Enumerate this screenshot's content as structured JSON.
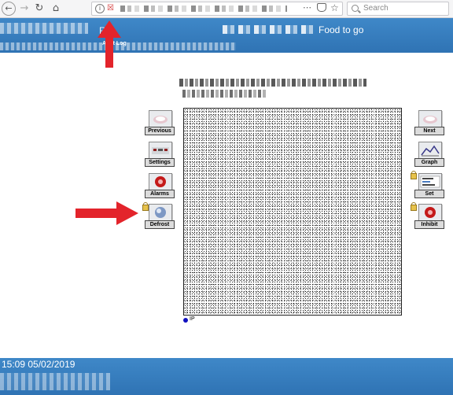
{
  "browser": {
    "search_placeholder": "Search"
  },
  "header": {
    "short_text": "R",
    "link_label": "Alert Log",
    "site_title": "Food to go"
  },
  "buttons_left": [
    {
      "label": "Previous"
    },
    {
      "label": "Settings"
    },
    {
      "label": "Alarms"
    },
    {
      "label": "Defrost"
    }
  ],
  "buttons_right": [
    {
      "label": "Next"
    },
    {
      "label": "Graph"
    },
    {
      "label": "Set"
    },
    {
      "label": "Inhibit"
    }
  ],
  "canvas": {
    "legend_label": "IP"
  },
  "footer": {
    "timestamp": "15:09 05/02/2019"
  },
  "colors": {
    "header_blue": "#3a80c0",
    "annotation_red": "#e3242b"
  }
}
